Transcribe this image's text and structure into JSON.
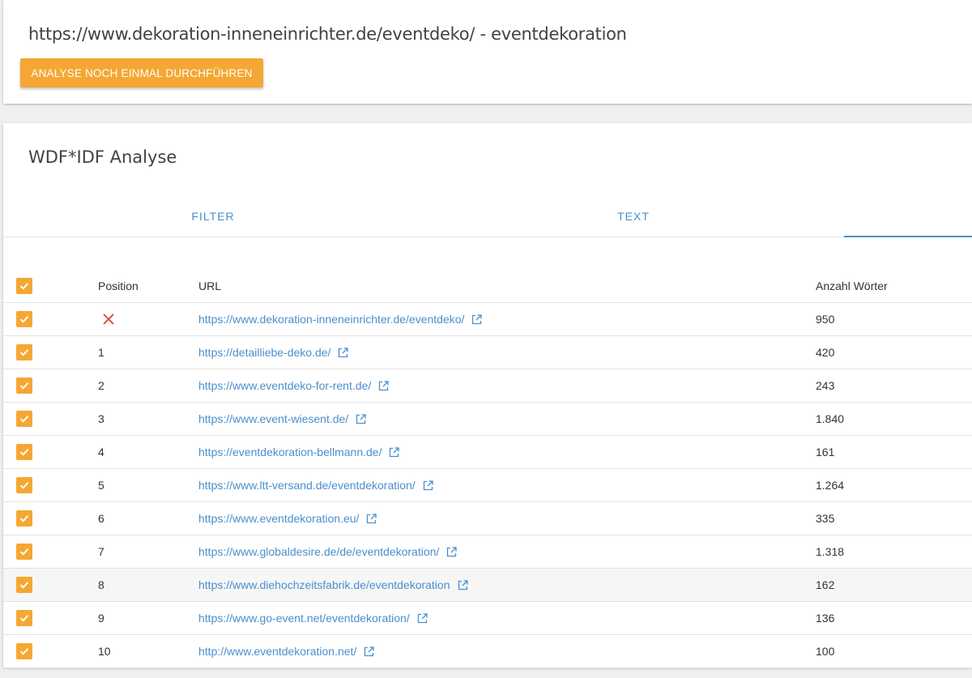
{
  "header": {
    "page_title": "https://www.dekoration-inneneinrichter.de/eventdeko/ - eventdekoration",
    "rerun_button_label": "ANALYSE NOCH EINMAL DURCHFÜHREN"
  },
  "analysis": {
    "title": "WDF*IDF Analyse",
    "tabs": [
      {
        "label": "FILTER"
      },
      {
        "label": "TEXT"
      },
      {
        "label": ""
      }
    ],
    "active_tab_index": 2
  },
  "table": {
    "columns": [
      "Position",
      "URL",
      "Anzahl Wörter"
    ],
    "header_checkbox_checked": true,
    "rows": [
      {
        "position": "",
        "position_icon": "close-icon",
        "url": "https://www.dekoration-inneneinrichter.de/eventdeko/",
        "words": "950",
        "checked": true
      },
      {
        "position": "1",
        "url": "https://detailliebe-deko.de/",
        "words": "420",
        "checked": true
      },
      {
        "position": "2",
        "url": "https://www.eventdeko-for-rent.de/",
        "words": "243",
        "checked": true
      },
      {
        "position": "3",
        "url": "https://www.event-wiesent.de/",
        "words": "1.840",
        "checked": true
      },
      {
        "position": "4",
        "url": "https://eventdekoration-bellmann.de/",
        "words": "161",
        "checked": true
      },
      {
        "position": "5",
        "url": "https://www.ltt-versand.de/eventdekoration/",
        "words": "1.264",
        "checked": true
      },
      {
        "position": "6",
        "url": "https://www.eventdekoration.eu/",
        "words": "335",
        "checked": true
      },
      {
        "position": "7",
        "url": "https://www.globaldesire.de/de/eventdekoration/",
        "words": "1.318",
        "checked": true
      },
      {
        "position": "8",
        "url": "https://www.diehochzeitsfabrik.de/eventdekoration",
        "words": "162",
        "checked": true
      },
      {
        "position": "9",
        "url": "https://www.go-event.net/eventdekoration/",
        "words": "136",
        "checked": true
      },
      {
        "position": "10",
        "url": "http://www.eventdekoration.net/",
        "words": "100",
        "checked": true
      }
    ]
  },
  "colors": {
    "accent_orange": "#f5a733",
    "link_blue": "#4a8fcd",
    "error_red": "#d9403a"
  },
  "icons": {
    "checkbox": "check-icon",
    "external_link": "external-link-icon",
    "own_site_marker": "close-icon"
  }
}
